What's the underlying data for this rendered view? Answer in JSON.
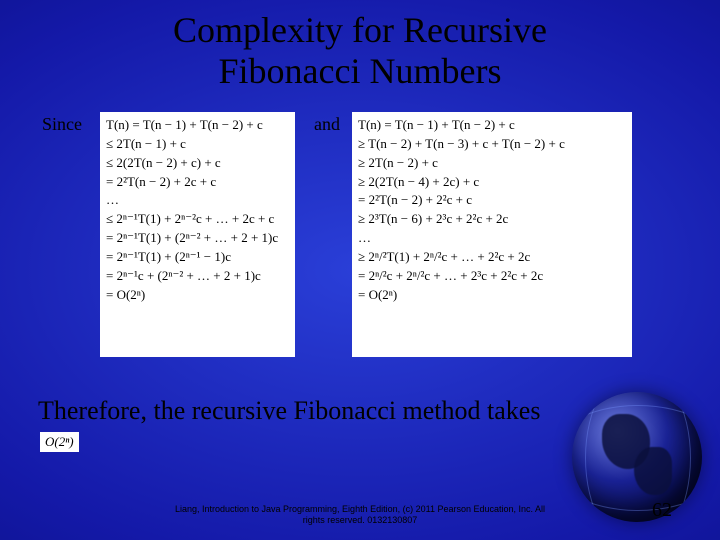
{
  "title_line1": "Complexity for Recursive",
  "title_line2": "Fibonacci Numbers",
  "labels": {
    "since": "Since",
    "and": "and"
  },
  "math_left": [
    "T(n) = T(n − 1) + T(n − 2) + c",
    "≤ 2T(n − 1) + c",
    "≤ 2(2T(n − 2) + c) + c",
    "= 2²T(n − 2) + 2c + c",
    "…",
    "≤ 2ⁿ⁻¹T(1) + 2ⁿ⁻²c + … + 2c + c",
    "= 2ⁿ⁻¹T(1) + (2ⁿ⁻² + … + 2 + 1)c",
    "= 2ⁿ⁻¹T(1) + (2ⁿ⁻¹ − 1)c",
    "= 2ⁿ⁻¹c + (2ⁿ⁻² + … + 2 + 1)c",
    "= O(2ⁿ)"
  ],
  "math_right": [
    "T(n) = T(n − 1) + T(n − 2) + c",
    "≥ T(n − 2) + T(n − 3) + c + T(n − 2) + c",
    "≥ 2T(n − 2) + c",
    "≥ 2(2T(n − 4) + 2c) + c",
    "= 2²T(n − 2) + 2²c + c",
    "≥ 2³T(n − 6) + 2³c + 2²c + 2c",
    "…",
    "≥ 2ⁿ/²T(1) + 2ⁿ/²c + … + 2²c + 2c",
    "= 2ⁿ/²c + 2ⁿ/²c + … + 2³c + 2²c + 2c",
    "= O(2ⁿ)"
  ],
  "conclusion": "Therefore, the recursive Fibonacci method takes",
  "complexity_box": "O(2ⁿ)",
  "footer_line1": "Liang, Introduction to Java Programming, Eighth Edition, (c) 2011 Pearson Education, Inc. All",
  "footer_line2": "rights reserved. 0132130807",
  "slide_number": "62",
  "colors": {
    "bg_center": "#2a3fd8",
    "bg_edge": "#050a70",
    "text": "#000000",
    "panel": "#ffffff"
  }
}
